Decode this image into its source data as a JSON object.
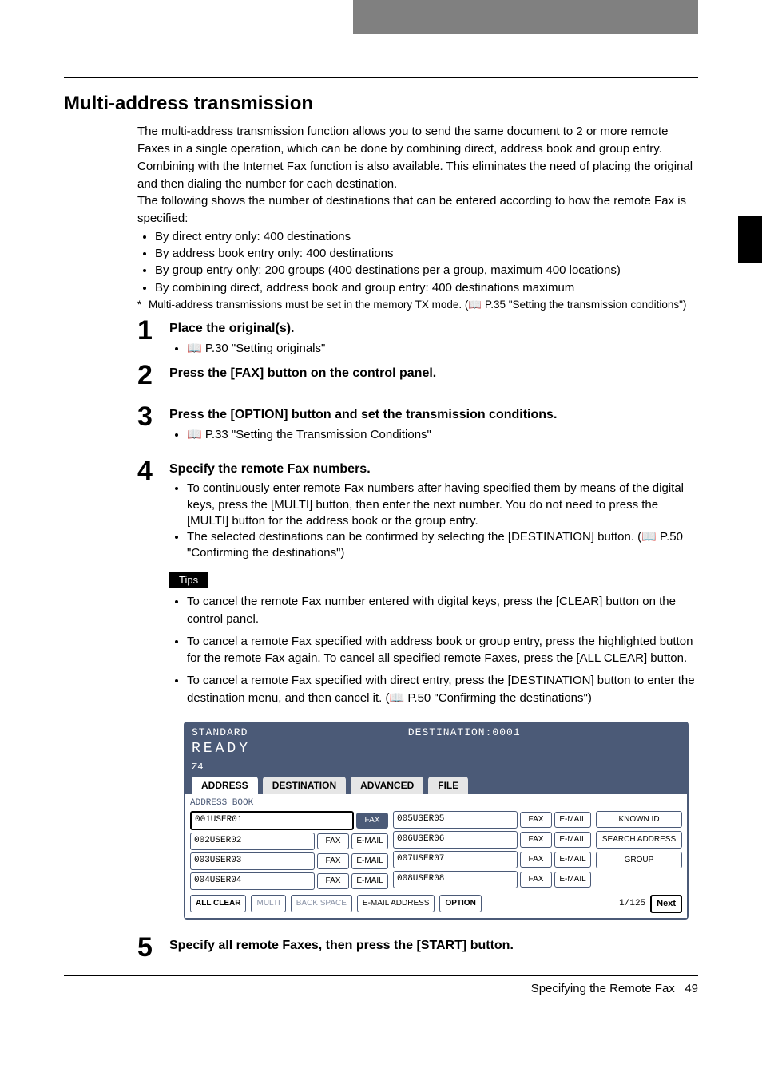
{
  "heading": "Multi-address transmission",
  "intro1": "The multi-address transmission function allows you to send the same document to 2 or more remote Faxes in a single operation, which can be done by combining direct, address book and group entry. Combining with the Internet Fax function is also available. This eliminates the need of placing the original and then dialing the number for each destination.",
  "intro2": "The following shows the number of destinations that can be entered according to how the remote Fax is specified:",
  "bullets": [
    "By direct entry only: 400 destinations",
    "By address book entry only: 400 destinations",
    "By group entry only: 200 groups (400 destinations per a group, maximum 400 locations)",
    "By combining direct, address book and group entry: 400 destinations maximum"
  ],
  "note": "Multi-address transmissions must be set in the memory TX mode. (📖 P.35 \"Setting the transmission conditions\")",
  "steps": [
    {
      "num": "1",
      "title": "Place the original(s).",
      "items": [
        "📖 P.30 \"Setting originals\""
      ]
    },
    {
      "num": "2",
      "title": "Press the [FAX] button on the control panel.",
      "items": []
    },
    {
      "num": "3",
      "title": "Press the [OPTION] button and set the transmission conditions.",
      "items": [
        "📖 P.33 \"Setting the Transmission Conditions\""
      ]
    },
    {
      "num": "4",
      "title": "Specify the remote Fax numbers.",
      "items": [
        "To continuously enter remote Fax numbers after having specified them by means of the digital keys, press the [MULTI] button, then enter the next number. You do not need to press the [MULTI] button for the address book or the group entry.",
        "The selected destinations can be confirmed by selecting the [DESTINATION] button. (📖 P.50 \"Confirming the destinations\")"
      ]
    },
    {
      "num": "5",
      "title": "Specify all remote Faxes, then press the [START] button.",
      "items": []
    }
  ],
  "tips_label": "Tips",
  "tips": [
    "To cancel the remote Fax number entered with digital keys, press the [CLEAR] button on the control panel.",
    "To cancel a remote Fax specified with address book or group entry, press the highlighted button for the remote Fax again. To cancel all specified remote Faxes, press the [ALL CLEAR] button.",
    "To cancel a remote Fax specified with direct entry, press the [DESTINATION] button to enter the destination menu, and then cancel it. (📖 P.50 \"Confirming the destinations\")"
  ],
  "screen": {
    "status1": "STANDARD",
    "dest_label": "DESTINATION:0001",
    "ready": "READY",
    "z4": "Z4",
    "tabs": {
      "address": "ADDRESS",
      "destination": "DESTINATION",
      "advanced": "ADVANCED",
      "file": "FILE"
    },
    "ab_label": "ADDRESS BOOK",
    "left_rows": [
      {
        "name": "001USER01",
        "selected": true
      },
      {
        "name": "002USER02",
        "selected": false
      },
      {
        "name": "003USER03",
        "selected": false
      },
      {
        "name": "004USER04",
        "selected": false
      }
    ],
    "right_rows": [
      {
        "name": "005USER05"
      },
      {
        "name": "006USER06"
      },
      {
        "name": "007USER07"
      },
      {
        "name": "008USER08"
      }
    ],
    "chip_fax": "FAX",
    "chip_email": "E-MAIL",
    "side_buttons": {
      "known": "KNOWN ID",
      "search": "SEARCH ADDRESS",
      "group": "GROUP"
    },
    "bottom": {
      "all_clear": "ALL CLEAR",
      "multi": "MULTI",
      "back": "BACK SPACE",
      "email_addr": "E-MAIL ADDRESS",
      "option": "OPTION",
      "pager": "1/125",
      "next": "Next"
    }
  },
  "footer": {
    "section": "Specifying the Remote Fax",
    "page": "49"
  }
}
